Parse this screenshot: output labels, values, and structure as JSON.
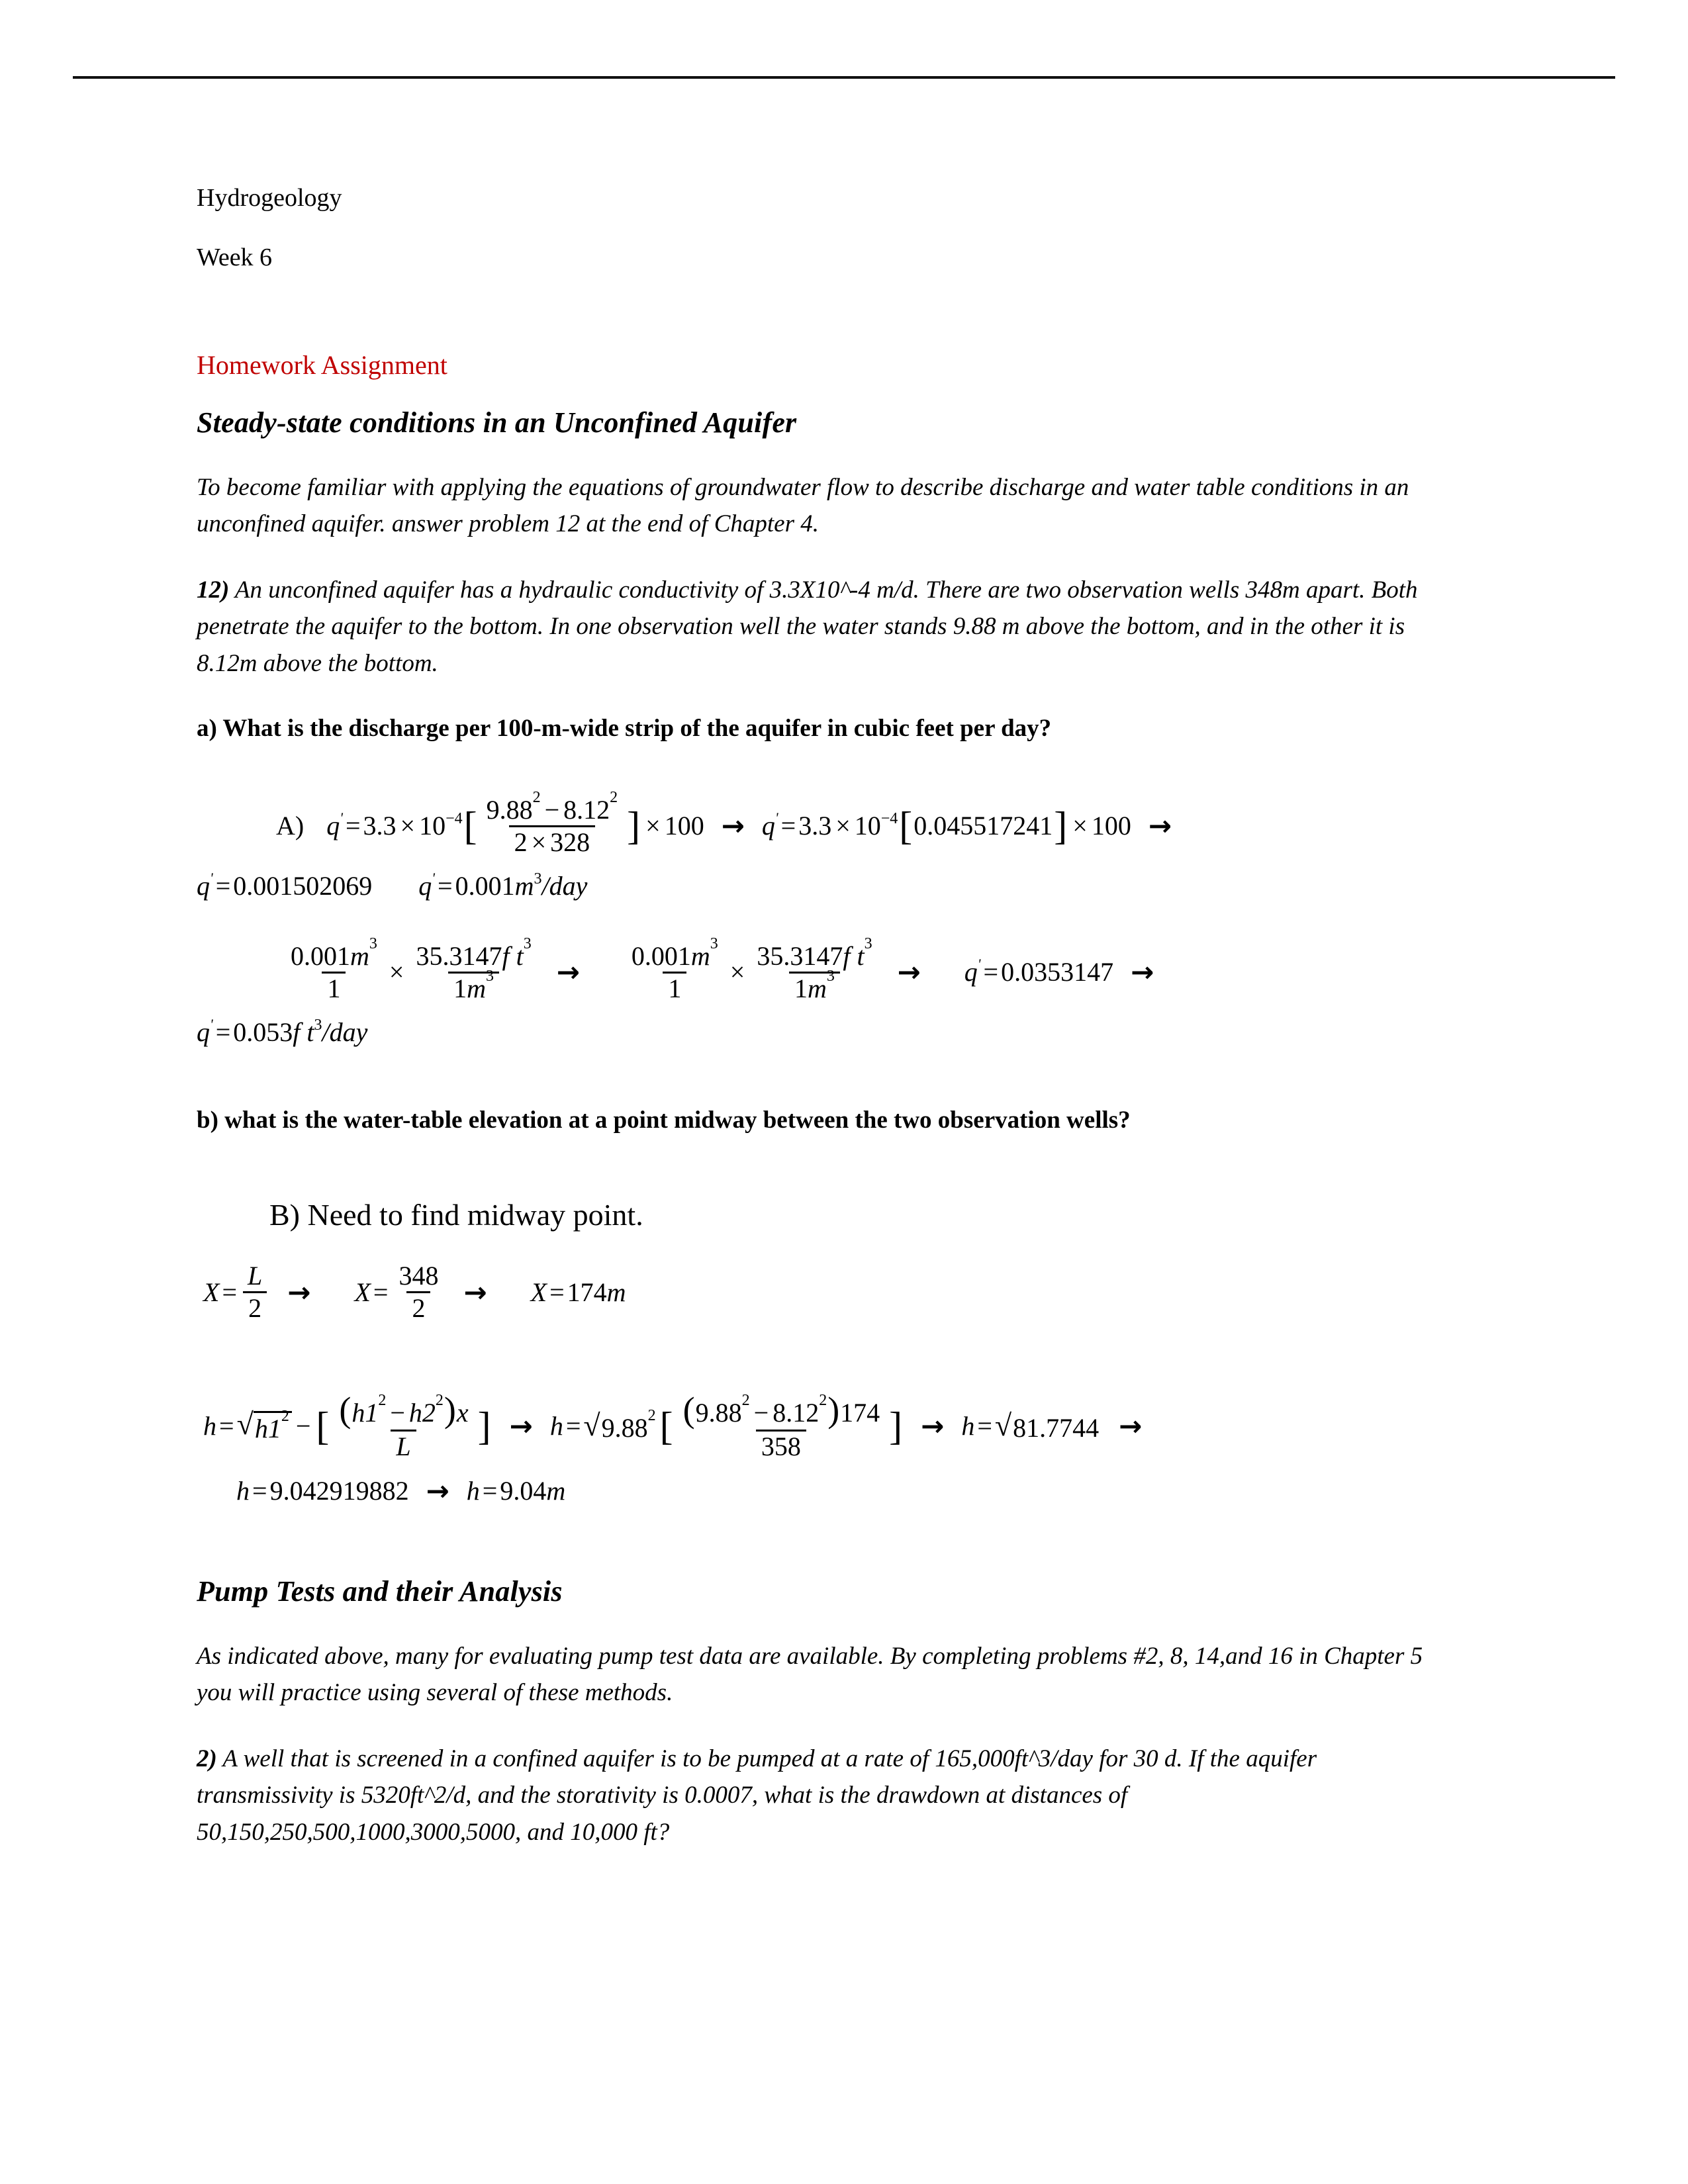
{
  "document": {
    "course": "Hydrogeology",
    "week": "Week 6",
    "assignment_label": "Homework Assignment",
    "assignment_color": "#C00000",
    "section1_title": "Steady-state conditions in an Unconfined Aquifer",
    "section1_intro": "To become familiar with applying the equations of groundwater flow to describe discharge and water table conditions in an unconfined aquifer. answer problem 12 at the end of Chapter 4.",
    "problem12_number": "12)",
    "problem12_text": " An unconfined aquifer has a hydraulic conductivity of 3.3X10^-4 m/d. There are two observation wells 348m apart. Both penetrate the aquifer to the bottom. In one observation well the water stands 9.88 m above the bottom, and in the other it is 8.12m above the bottom.",
    "question_a": "a) What is the discharge per 100-m-wide strip of the aquifer in cubic feet per day?",
    "question_b": "b) what is the water-table elevation at a point midway between the two observation wells?",
    "answer_b_heading": "B) Need to find midway point.",
    "section2_title": "Pump Tests and their Analysis",
    "section2_intro": "As indicated above, many for evaluating pump test data are available. By completing problems #2, 8, 14,and 16 in Chapter 5 you will practice using several of these methods.",
    "problem2_number": "2)",
    "problem2_text": " A well that is screened in a confined aquifer is to be pumped at a rate of 165,000ft^3/day for 30 d. If the aquifer transmissivity is 5320ft^2/d, and the storativity is 0.0007, what is the drawdown at distances of 50,150,250,500,1000,3000,5000, and 10,000 ft?"
  },
  "math": {
    "a_label": "A)",
    "var_q": "q",
    "var_h": "h",
    "var_X": "X",
    "var_L": "L",
    "var_x": "x",
    "eq_sign": "=",
    "times": "×",
    "minus": "−",
    "arrow": "→",
    "radical": "√",
    "bracket_open": "[",
    "bracket_close": "]",
    "paren_open": "(",
    "paren_close": ")",
    "slash": "/",
    "k_coeff": "3.3",
    "ten": "10",
    "exp_neg4": "−4",
    "h1": "9.88",
    "h2": "8.12",
    "sq": "2",
    "cube": "3",
    "two": "2",
    "L_val": "328",
    "width_100": "100",
    "bracket_val": "0.045517241",
    "q_full": "0.001502069",
    "q_round": "0.001",
    "unit_m": "m",
    "unit_day": "day",
    "unit_ft": "f t",
    "one": "1",
    "conv_factor": "35.3147",
    "q_ft_full": "0.0353147",
    "q_ft_round": "0.053",
    "L_total": "348",
    "X_result": "174",
    "h1_label": "h1",
    "h2_label": "h2",
    "L_sym": "L",
    "x_sym": "x",
    "L_358": "358",
    "x_174": "174",
    "radicand_val": "81.7744",
    "h_full": "9.042919882",
    "h_round": "9.04"
  }
}
